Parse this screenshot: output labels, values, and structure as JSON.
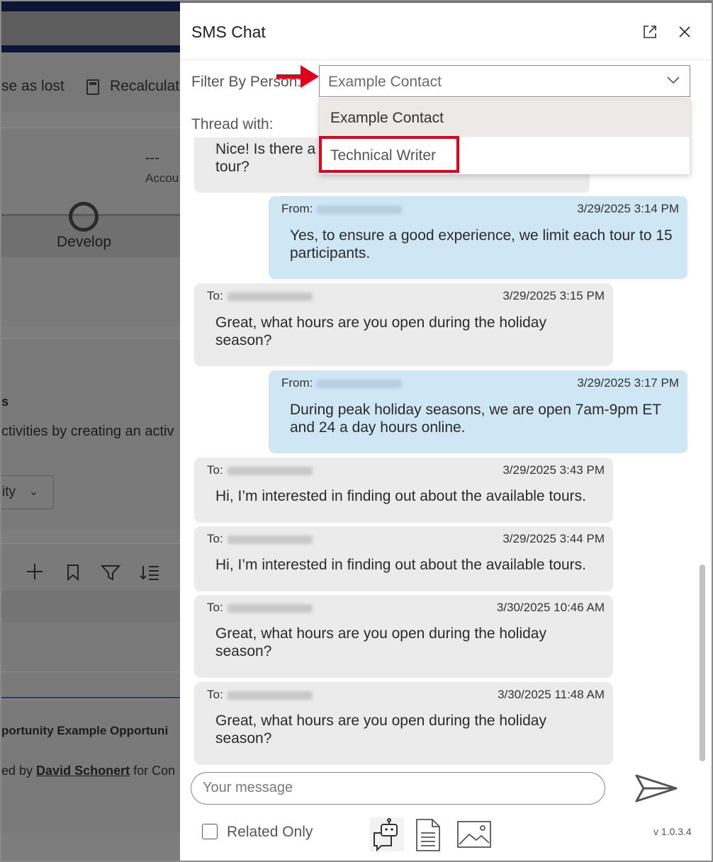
{
  "background_app": {
    "commands": [
      "se as lost",
      "Recalculate"
    ],
    "stage_dashes": "---",
    "stage_accou": "Accou",
    "stage_name": "Develop",
    "activities_head": "s",
    "activities_text": "ctivities by creating an activ",
    "activity_btn": "ity",
    "record_title": "portunity Example Opportuni",
    "created_prefix": "ed by ",
    "created_by": "David Schonert",
    "created_suffix": " for Con"
  },
  "sms": {
    "title": "SMS Chat",
    "filter_label": "Filter By Person:",
    "filter_value": "Example Contact",
    "dropdown_options": [
      "Example Contact",
      "Technical Writer"
    ],
    "thread_label": "Thread with:",
    "messages": [
      {
        "dir": "in",
        "meta": "",
        "time": "",
        "text": [
          "Nice! Is there a",
          "tour?"
        ]
      },
      {
        "dir": "out",
        "meta": "From:",
        "time": "3/29/2025 3:14 PM",
        "text": [
          "Yes, to ensure a good experience, we limit each tour to 15",
          "participants."
        ]
      },
      {
        "dir": "in",
        "meta": "To:",
        "time": "3/29/2025 3:15 PM",
        "text": [
          "Great, what hours are you open during the holiday",
          "season?"
        ]
      },
      {
        "dir": "out",
        "meta": "From:",
        "time": "3/29/2025 3:17 PM",
        "text": [
          "During peak holiday seasons, we are open 7am-9pm ET",
          "and 24 a day hours online."
        ]
      },
      {
        "dir": "in",
        "meta": "To:",
        "time": "3/29/2025 3:43 PM",
        "text": [
          "Hi, I’m interested in finding out about the available tours."
        ]
      },
      {
        "dir": "in",
        "meta": "To:",
        "time": "3/29/2025 3:44 PM",
        "text": [
          "Hi, I’m interested in finding out about the available tours."
        ]
      },
      {
        "dir": "in",
        "meta": "To:",
        "time": "3/30/2025 10:46 AM",
        "text": [
          "Great, what hours are you open during the holiday",
          "season?"
        ]
      },
      {
        "dir": "in",
        "meta": "To:",
        "time": "3/30/2025 11:48 AM",
        "text": [
          "Great, what hours are you open during the holiday",
          "season?"
        ]
      }
    ],
    "message_placeholder": "Your message",
    "related_only_label": "Related Only",
    "version": "v 1.0.3.4"
  },
  "colors": {
    "incoming_bubble": "#ebebeb",
    "outgoing_bubble": "#cfe6f5",
    "highlight": "#e0001b"
  }
}
